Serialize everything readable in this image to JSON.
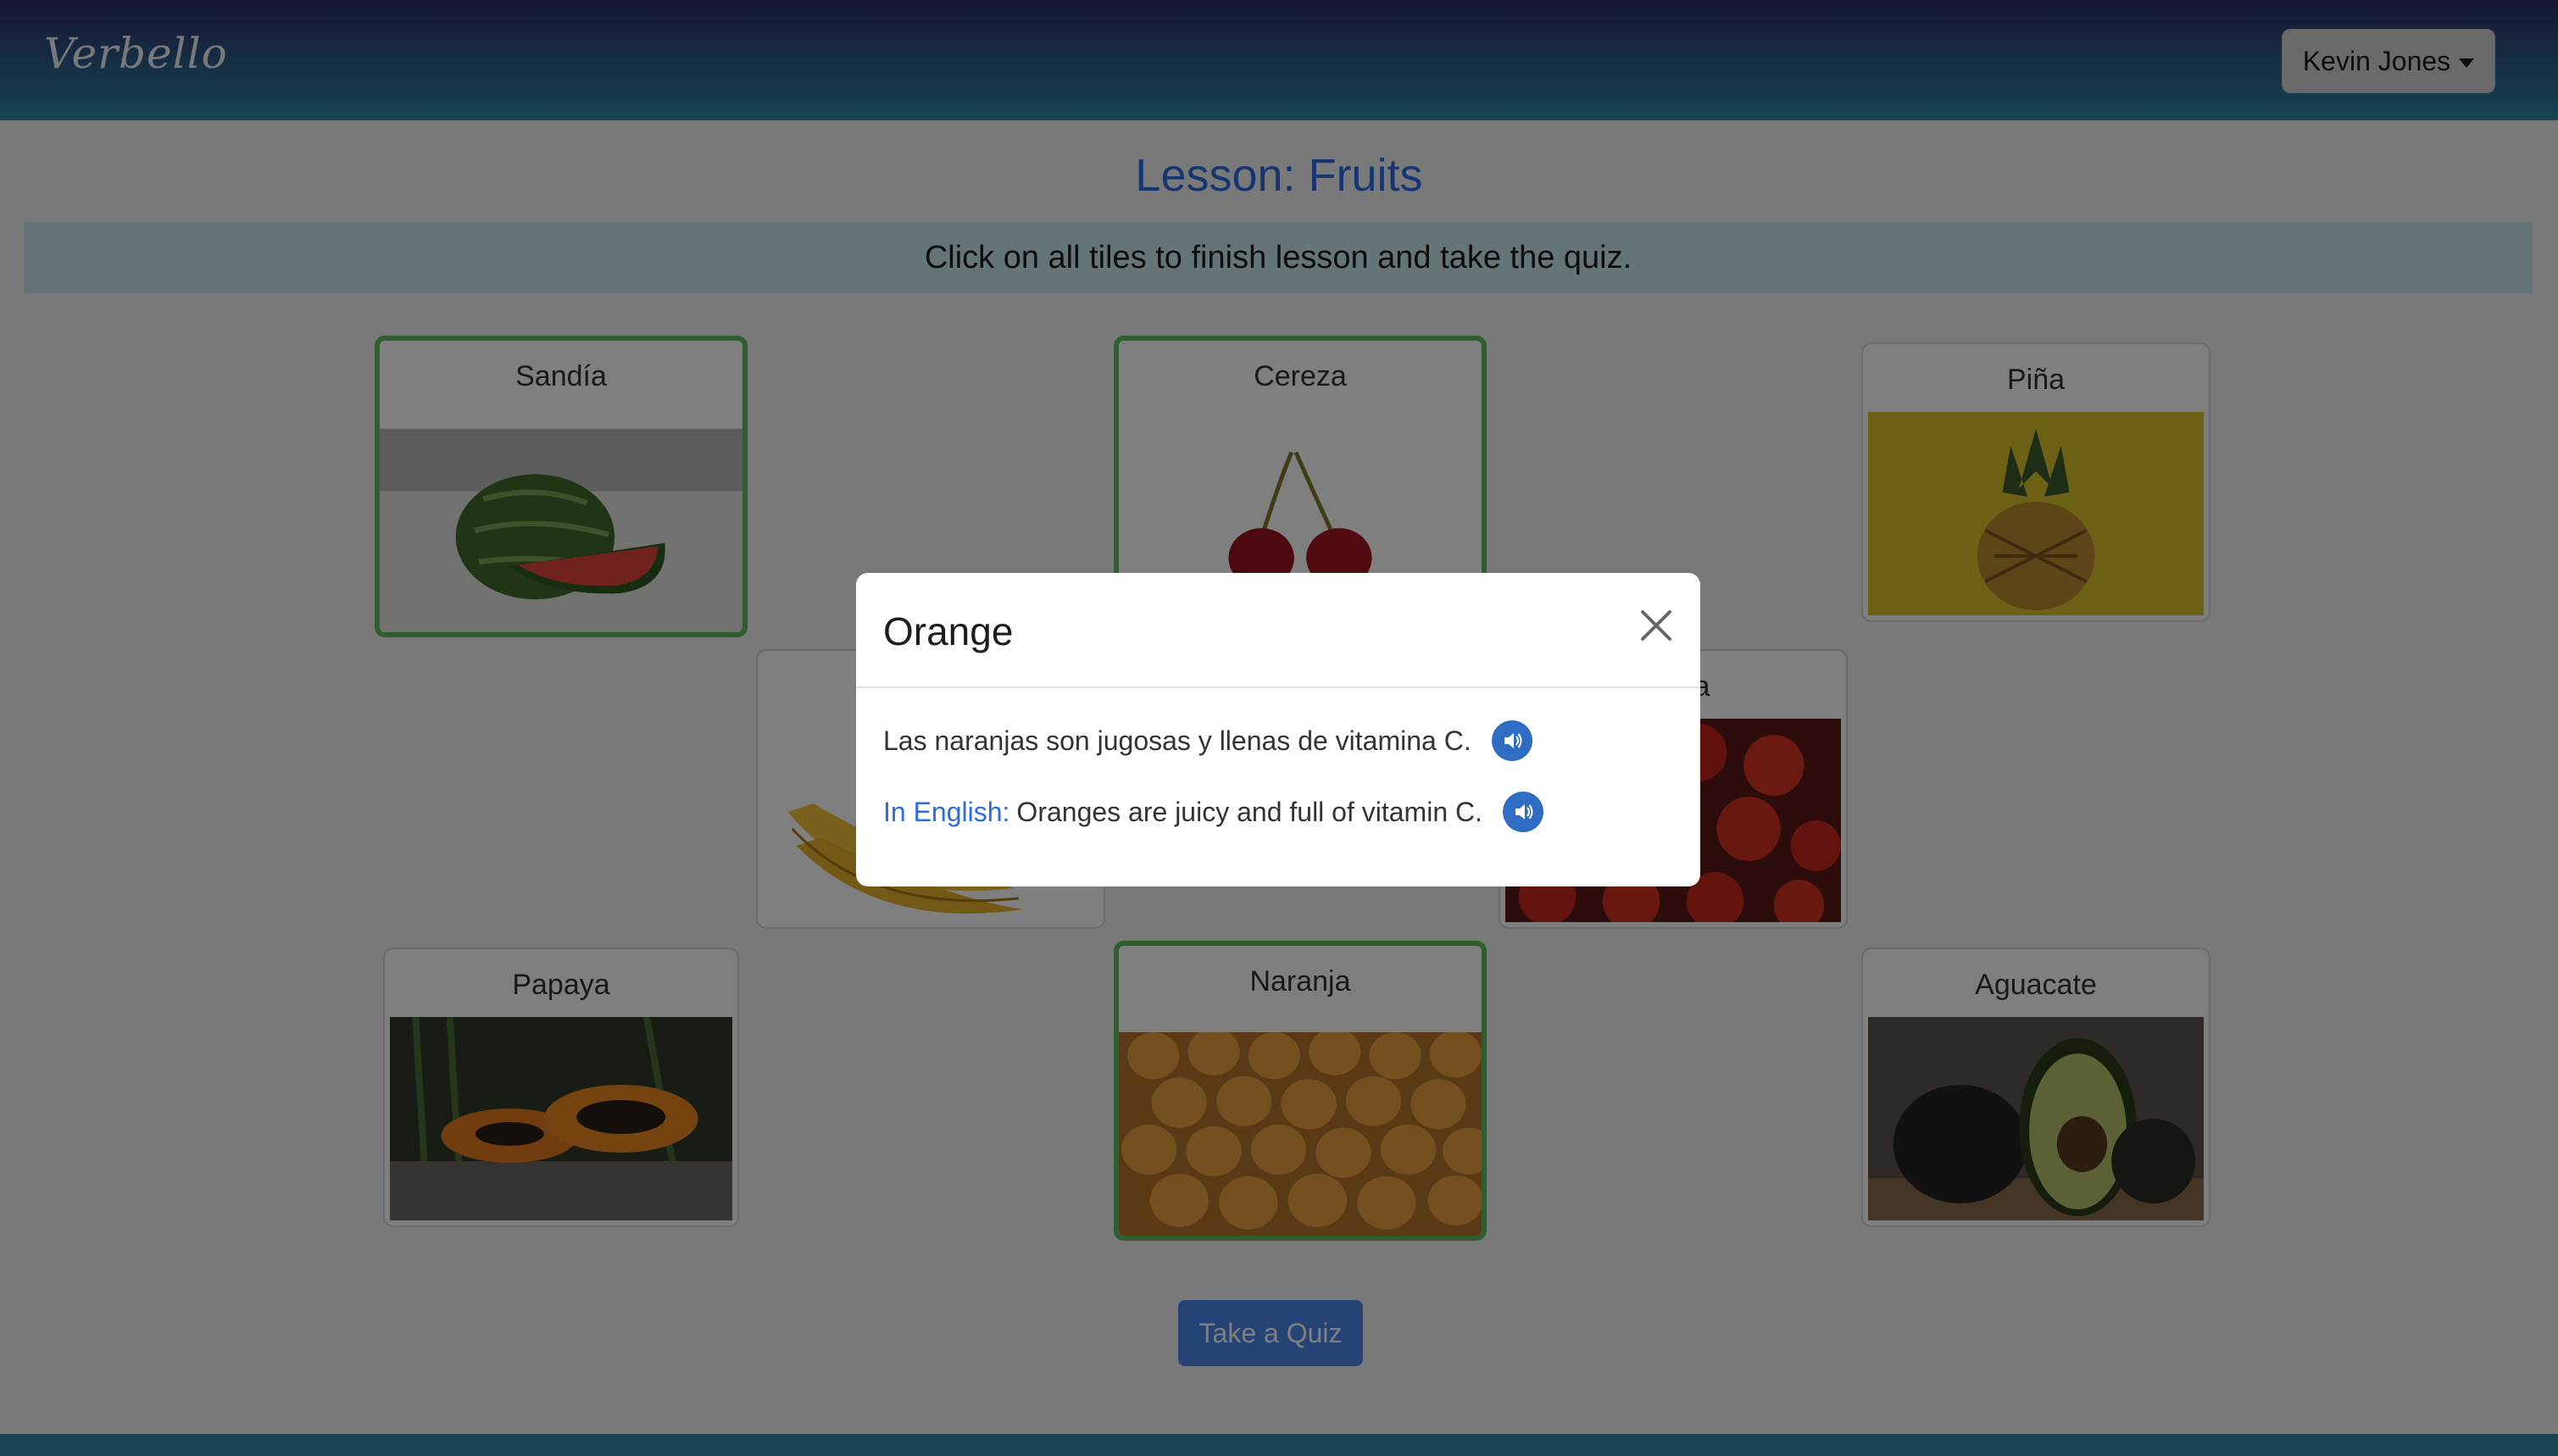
{
  "navbar": {
    "brand": "Verbello",
    "user_name": "Kevin Jones"
  },
  "lesson": {
    "title": "Lesson: Fruits",
    "instructions": "Click on all tiles to finish lesson and take the quiz."
  },
  "tiles": [
    {
      "label": "Sandía",
      "completed": true
    },
    {
      "label": "Cereza",
      "completed": true
    },
    {
      "label": "Piña",
      "completed": false
    },
    {
      "label": "Plátano",
      "completed": false
    },
    {
      "label": "Fresa",
      "completed": false
    },
    {
      "label": "Papaya",
      "completed": false
    },
    {
      "label": "Naranja",
      "completed": true
    },
    {
      "label": "Aguacate",
      "completed": false
    }
  ],
  "quiz_button": "Take a Quiz",
  "modal": {
    "title": "Orange",
    "sentence_es": "Las naranjas son jugosas y llenas de vitamina C.",
    "english_label": "In English:",
    "sentence_en": "Oranges are juicy and full of vitamin C."
  },
  "icons": {
    "speak": "speaker-icon",
    "close": "close-icon",
    "caret": "caret-down-icon"
  },
  "colors": {
    "accent": "#2f6be0",
    "completed_border": "#5fbf5f",
    "speaker_button": "#2f6cc4"
  }
}
